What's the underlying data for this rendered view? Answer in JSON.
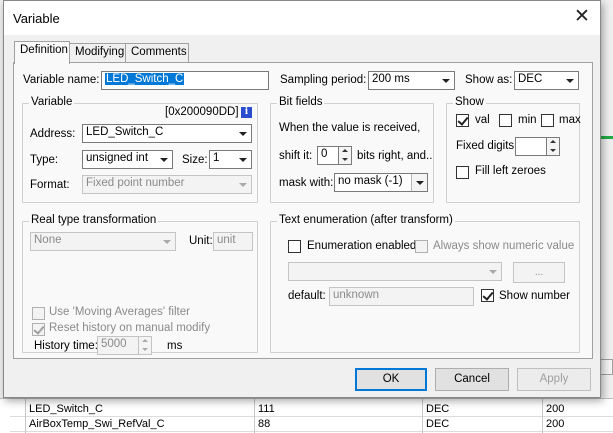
{
  "background": {
    "header_partial": "s]",
    "rows": [
      {
        "name": "LED_Switch_C",
        "value": "111",
        "show": "DEC",
        "period": "200"
      },
      {
        "name": "AirBoxTemp_Swi_RefVal_C",
        "value": "88",
        "show": "DEC",
        "period": "200"
      }
    ]
  },
  "dialog": {
    "title": "Variable",
    "close_glyph": "✕",
    "tabs": [
      {
        "label": "Definition"
      },
      {
        "label": "Modifying"
      },
      {
        "label": "Comments"
      }
    ],
    "variable_name_label": "Variable name:",
    "variable_name_value": "LED_Switch_C",
    "sampling_period_label": "Sampling period:",
    "sampling_period_value": "200 ms",
    "show_as_label": "Show as:",
    "show_as_value": "DEC",
    "variable_group": {
      "title": "Variable",
      "address_hex": "[0x200090DD]",
      "info_icon": "i",
      "address_label": "Address:",
      "address_value": "LED_Switch_C",
      "type_label": "Type:",
      "type_value": "unsigned int",
      "size_label": "Size:",
      "size_value": "1",
      "format_label": "Format:",
      "format_value": "Fixed point number"
    },
    "bit_fields": {
      "title": "Bit fields",
      "description": "When the value is received,",
      "shift_label": "shift it:",
      "shift_value": "0",
      "shift_suffix": "bits right, and..",
      "mask_label": "mask with:",
      "mask_value": "no mask (-1)"
    },
    "show_group": {
      "title": "Show",
      "val_label": "val",
      "val_checked": true,
      "min_label": "min",
      "min_checked": false,
      "max_label": "max",
      "max_checked": false,
      "fixed_digits_label": "Fixed digits:",
      "fixed_digits_value": "",
      "fill_zeroes_label": "Fill left zeroes",
      "fill_zeroes_checked": false
    },
    "real_type": {
      "title": "Real type transformation",
      "value": "None",
      "unit_label": "Unit:",
      "unit_placeholder": "unit",
      "moving_avg_label": "Use 'Moving Averages' filter",
      "moving_avg_checked": false,
      "reset_history_label": "Reset history on manual modify",
      "reset_history_checked": true,
      "history_time_label": "History time:",
      "history_time_value": "5000",
      "history_time_unit": "ms"
    },
    "text_enum": {
      "title": "Text enumeration (after transform)",
      "enum_enabled_label": "Enumeration enabled",
      "enum_enabled_checked": false,
      "always_numeric_label": "Always show numeric value",
      "always_numeric_checked": false,
      "combo_value": "",
      "ellipsis_label": "...",
      "default_label": "default:",
      "default_placeholder": "unknown",
      "show_number_label": "Show number",
      "show_number_checked": true
    },
    "buttons": {
      "ok": "OK",
      "cancel": "Cancel",
      "apply": "Apply"
    }
  }
}
